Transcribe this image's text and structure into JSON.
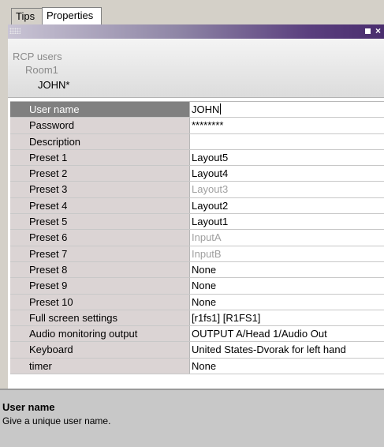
{
  "tabs": [
    {
      "label": "Tips",
      "active": false
    },
    {
      "label": "Properties",
      "active": true
    }
  ],
  "breadcrumb": [
    "RCP users",
    "Room1",
    "JOHN*"
  ],
  "properties": [
    {
      "name": "User name",
      "value": "JOHN",
      "selected": true,
      "dim": false
    },
    {
      "name": "Password",
      "value": "********",
      "selected": false,
      "dim": false
    },
    {
      "name": "Description",
      "value": "",
      "selected": false,
      "dim": false
    },
    {
      "name": "Preset 1",
      "value": "Layout5",
      "selected": false,
      "dim": false
    },
    {
      "name": "Preset 2",
      "value": "Layout4",
      "selected": false,
      "dim": false
    },
    {
      "name": "Preset 3",
      "value": "Layout3",
      "selected": false,
      "dim": true
    },
    {
      "name": "Preset 4",
      "value": "Layout2",
      "selected": false,
      "dim": false
    },
    {
      "name": "Preset 5",
      "value": "Layout1",
      "selected": false,
      "dim": false
    },
    {
      "name": "Preset 6",
      "value": "InputA",
      "selected": false,
      "dim": true
    },
    {
      "name": "Preset 7",
      "value": "InputB",
      "selected": false,
      "dim": true
    },
    {
      "name": "Preset 8",
      "value": "None",
      "selected": false,
      "dim": false
    },
    {
      "name": "Preset 9",
      "value": "None",
      "selected": false,
      "dim": false
    },
    {
      "name": "Preset 10",
      "value": "None",
      "selected": false,
      "dim": false
    },
    {
      "name": "Full screen settings",
      "value": "[r1fs1] [R1FS1]",
      "selected": false,
      "dim": false
    },
    {
      "name": "Audio monitoring output",
      "value": "OUTPUT A/Head 1/Audio Out",
      "selected": false,
      "dim": false
    },
    {
      "name": "Keyboard",
      "value": "United States-Dvorak for left hand",
      "selected": false,
      "dim": false
    },
    {
      "name": "timer",
      "value": "None",
      "selected": false,
      "dim": false
    }
  ],
  "description": {
    "title": "User name",
    "text": "Give a unique user name."
  },
  "titlebar": {
    "max_icon": "restore-icon",
    "close_label": "×"
  }
}
